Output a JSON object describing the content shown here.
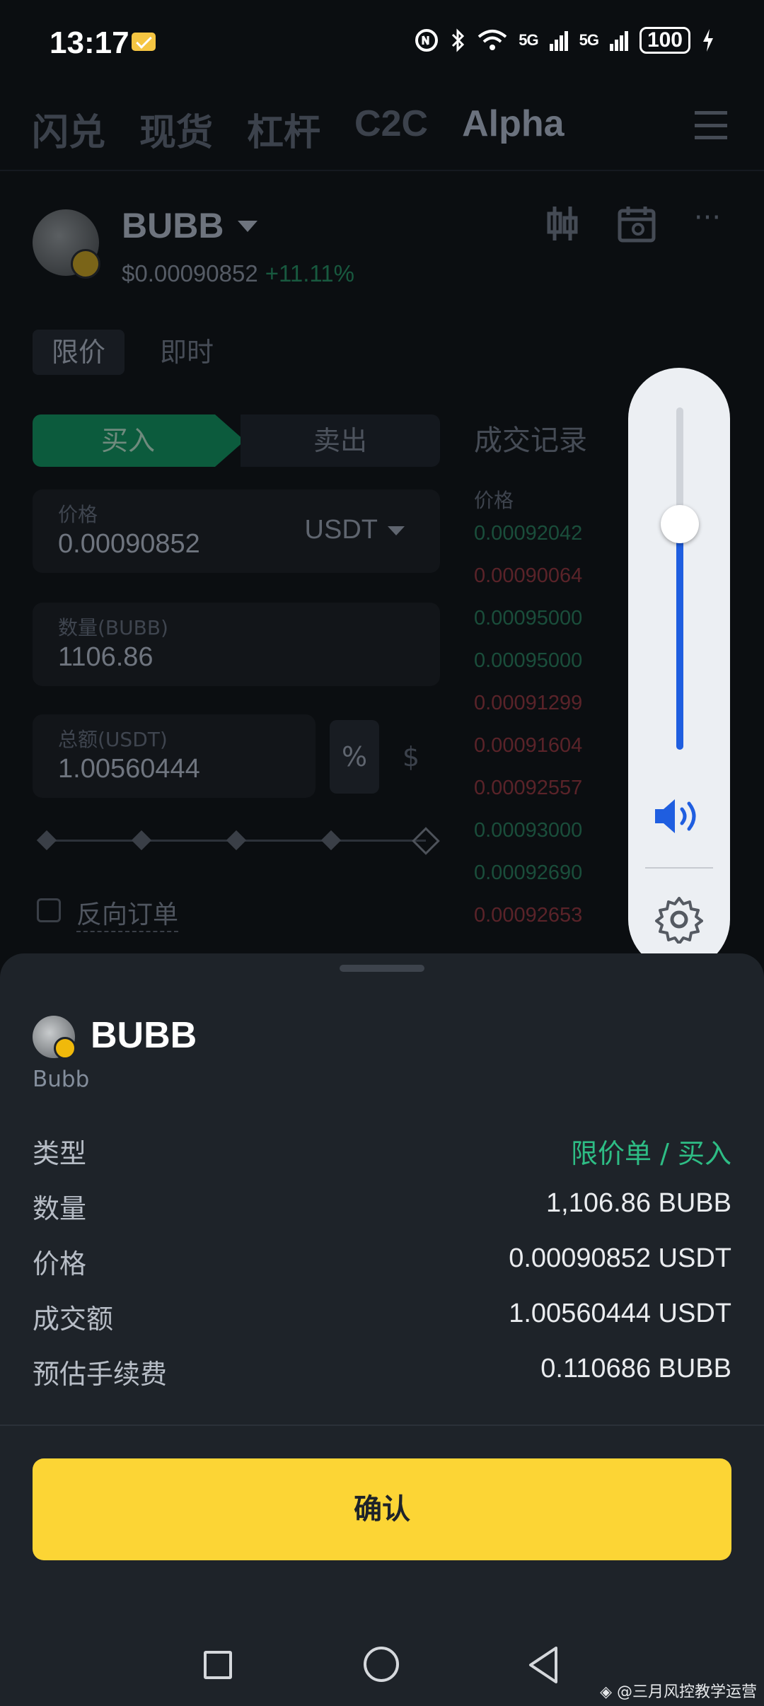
{
  "status_bar": {
    "time": "13:17",
    "signal1": "5G",
    "signal2": "5G",
    "battery": "100"
  },
  "top_tabs": [
    "闪兑",
    "现货",
    "杠杆",
    "C2C",
    "Alpha"
  ],
  "coin": {
    "symbol": "BUBB",
    "price": "$0.00090852",
    "change": "+11.11%"
  },
  "order_mode": {
    "active": "限价",
    "other": "即时"
  },
  "side_toggle": {
    "buy": "买入",
    "sell": "卖出"
  },
  "price_field": {
    "label": "价格",
    "value": "0.00090852",
    "currency": "USDT"
  },
  "qty_field": {
    "label": "数量(BUBB)",
    "value": "1106.86"
  },
  "total_field": {
    "label": "总额(USDT)",
    "value": "1.00560444",
    "pct": "%",
    "usd": "$"
  },
  "reverse_order": "反向订单",
  "trades": {
    "title": "成交记录",
    "price_header": "价格",
    "rows": [
      {
        "price": "0.00092042",
        "dir": "up"
      },
      {
        "price": "0.00090064",
        "dir": "down"
      },
      {
        "price": "0.00095000",
        "dir": "up"
      },
      {
        "price": "0.00095000",
        "dir": "up"
      },
      {
        "price": "0.00091299",
        "dir": "down"
      },
      {
        "price": "0.00091604",
        "dir": "down"
      },
      {
        "price": "0.00092557",
        "dir": "down"
      },
      {
        "price": "0.00093000",
        "dir": "up"
      },
      {
        "price": "0.00092690",
        "dir": "up"
      },
      {
        "price": "0.00092653",
        "dir": "down"
      }
    ]
  },
  "volume": {
    "level": 0.66
  },
  "sheet": {
    "symbol": "BUBB",
    "full_name": "Bubb",
    "rows": [
      {
        "label": "类型",
        "value": "限价单 / 买入"
      },
      {
        "label": "数量",
        "value": "1,106.86 BUBB"
      },
      {
        "label": "价格",
        "value": "0.00090852 USDT"
      },
      {
        "label": "成交额",
        "value": "1.00560444 USDT"
      },
      {
        "label": "预估手续费",
        "value": "0.110686 BUBB"
      }
    ],
    "confirm": "确认"
  },
  "watermark": "◈ @三月风控教学运营",
  "colors": {
    "accent": "#fcd535",
    "buy": "#2ebd85",
    "sell": "#f6465d",
    "volume": "#1f5ee0"
  }
}
